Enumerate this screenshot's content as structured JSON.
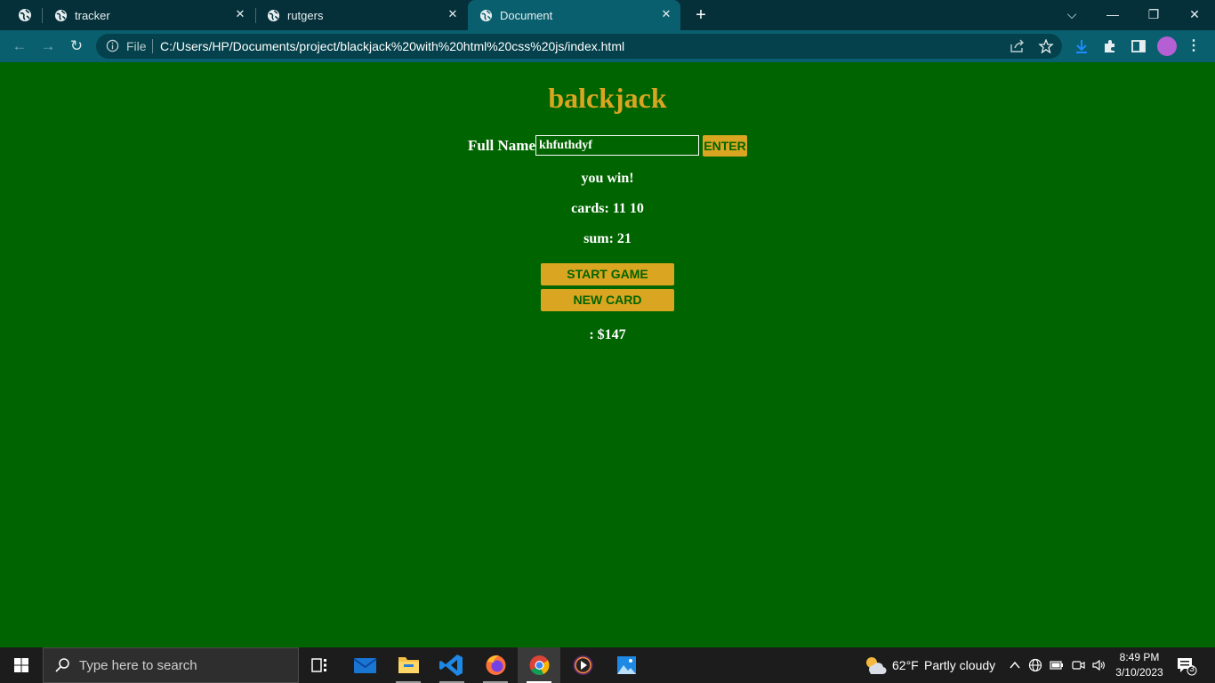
{
  "browser": {
    "tabs": [
      {
        "label": "",
        "icon": "globe-icon"
      },
      {
        "label": "tracker",
        "icon": "globe-icon"
      },
      {
        "label": "rutgers",
        "icon": "globe-icon"
      },
      {
        "label": "Document",
        "icon": "globe-icon",
        "active": true
      }
    ],
    "new_tab_label": "+",
    "address": {
      "scheme_label": "File",
      "url": "C:/Users/HP/Documents/project/blackjack%20with%20html%20css%20js/index.html"
    }
  },
  "page": {
    "title": "balckjack",
    "name_label": "Full Name",
    "name_value": "khfuthdyf",
    "enter_label": "ENTER",
    "message": "you win!",
    "cards_text": "cards: 11 10",
    "sum_text": "sum: 21",
    "start_label": "START GAME",
    "new_card_label": "NEW CARD",
    "player_text": ": $147",
    "colors": {
      "background": "#006400",
      "accent": "#daa520",
      "text": "#ffffff"
    }
  },
  "taskbar": {
    "search_placeholder": "Type here to search",
    "weather_temp": "62°F",
    "weather_desc": "Partly cloudy",
    "time": "8:49 PM",
    "date": "3/10/2023",
    "notification_count": "3",
    "apps": [
      "task-view",
      "mail",
      "file-explorer",
      "vscode",
      "firefox",
      "chrome",
      "media-player",
      "photos"
    ]
  }
}
